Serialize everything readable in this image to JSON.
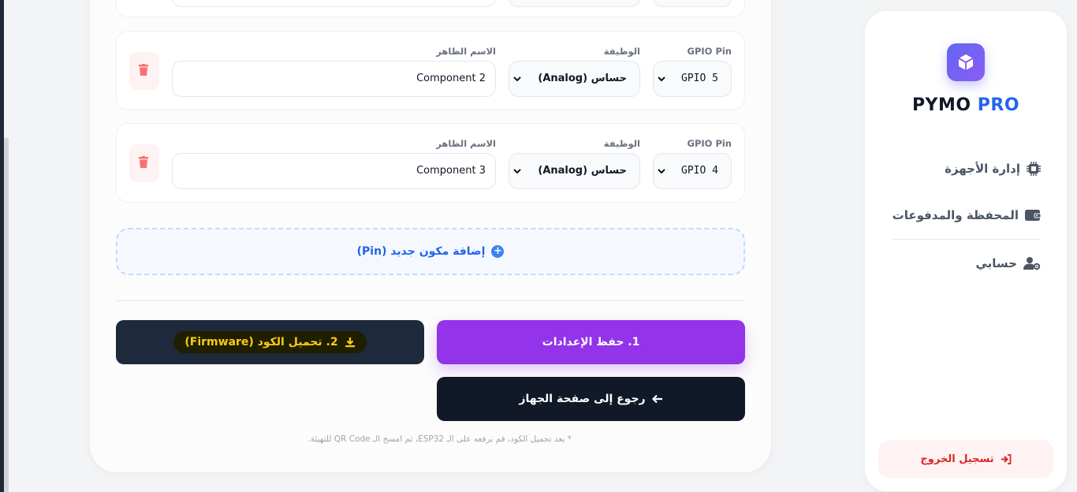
{
  "brand": {
    "name": "PYMO",
    "suffix": "PRO"
  },
  "sidebar": {
    "items": [
      {
        "label": "إدارة الأجهزة",
        "icon": "chip-icon"
      },
      {
        "label": "المحفظة والمدفوعات",
        "icon": "wallet-icon"
      },
      {
        "label": "حسابي",
        "icon": "user-gear-icon"
      }
    ],
    "logout": "تسجيل الخروج"
  },
  "pins": {
    "labels": {
      "gpio": "GPIO Pin",
      "function": "الوظيفة",
      "name": "الاسم الظاهر"
    },
    "rows": [
      {
        "gpio": "GPIO 5",
        "function": "حساس (Analog)",
        "name": "Component 2"
      },
      {
        "gpio": "GPIO 4",
        "function": "حساس (Analog)",
        "name": "Component 3"
      }
    ]
  },
  "actions": {
    "add_pin": "إضافة مكون جديد (Pin)",
    "save": "1. حفظ الإعدادات",
    "download": "2. تحميل الكود (Firmware)",
    "back": "رجوع إلى صفحة الجهاز"
  },
  "footnote": "* بعد تحميل الكود، قم برفعه على الـ ESP32، ثم امسح الـ QR Code للتهيئة.",
  "colors": {
    "accent_purple": "#9333ea",
    "brand_blue": "#2563eb",
    "danger": "#dc2626",
    "dark": "#111827"
  }
}
